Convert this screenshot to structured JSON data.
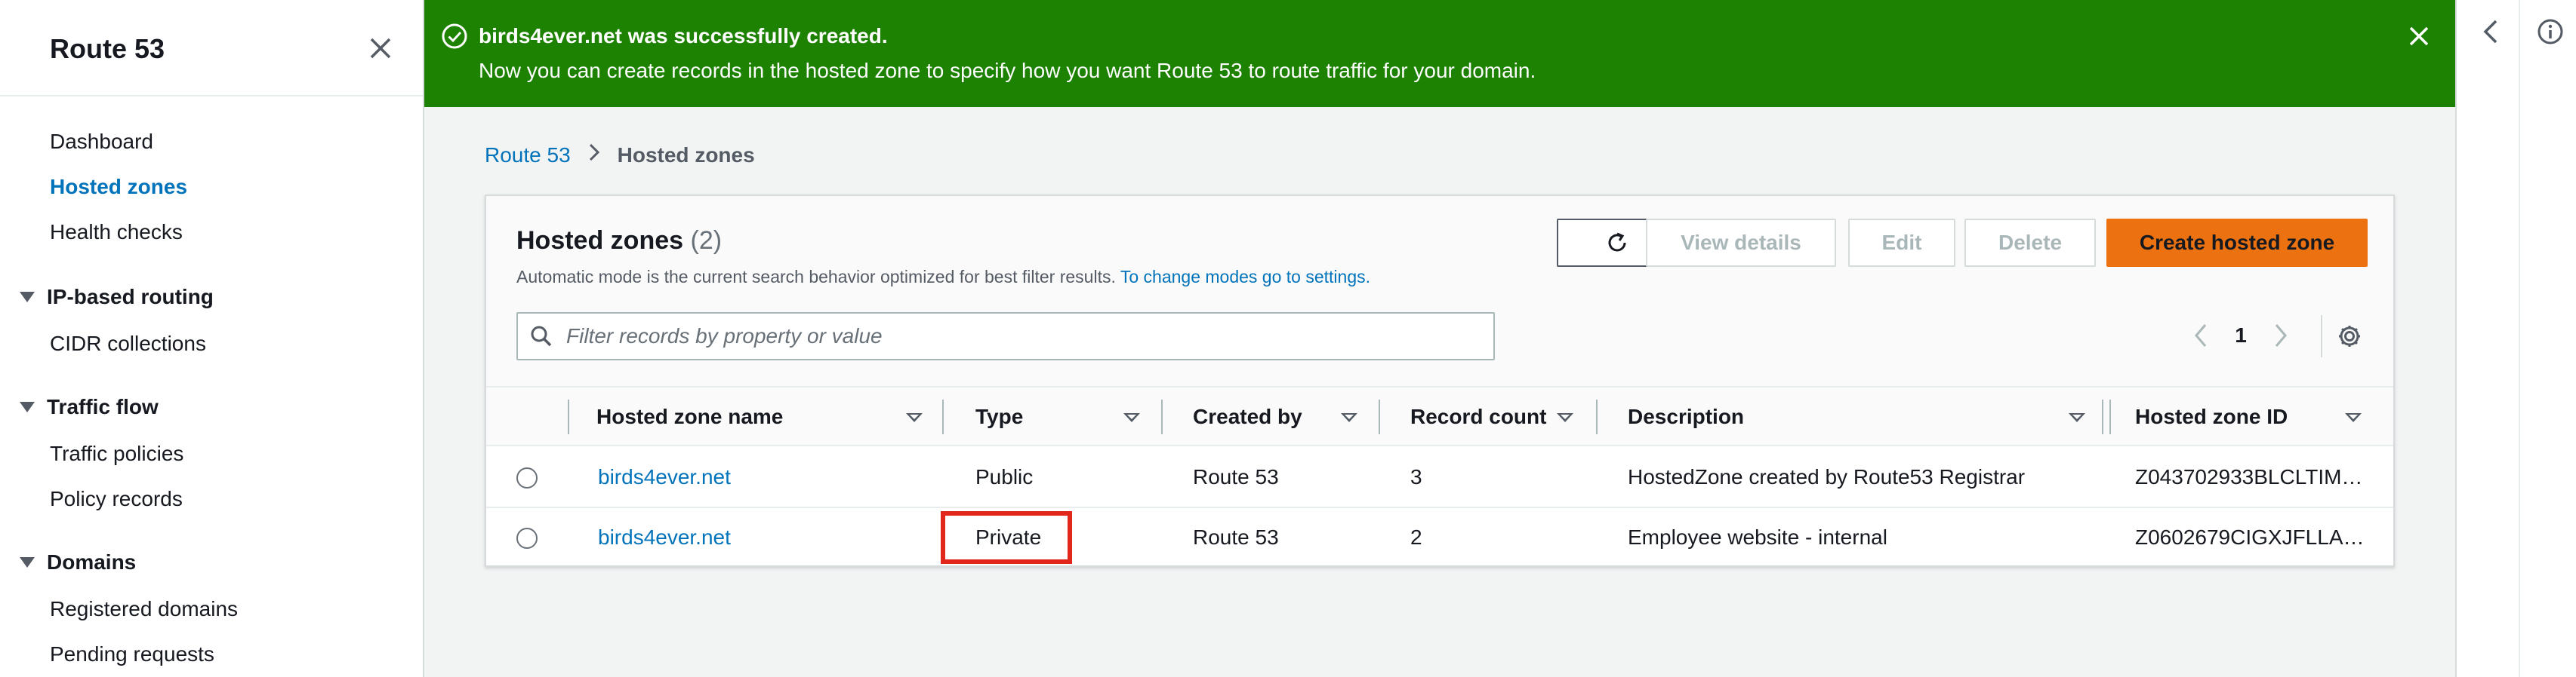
{
  "sidebar": {
    "title": "Route 53",
    "items": [
      {
        "label": "Dashboard"
      },
      {
        "label": "Hosted zones"
      },
      {
        "label": "Health checks"
      }
    ],
    "sections": [
      {
        "label": "IP-based routing",
        "items": [
          "CIDR collections"
        ]
      },
      {
        "label": "Traffic flow",
        "items": [
          "Traffic policies",
          "Policy records"
        ]
      },
      {
        "label": "Domains",
        "items": [
          "Registered domains",
          "Pending requests"
        ]
      }
    ]
  },
  "flash": {
    "title": "birds4ever.net was successfully created.",
    "message": "Now you can create records in the hosted zone to specify how you want Route 53 to route traffic for your domain.",
    "color": "#1d8102"
  },
  "breadcrumb": {
    "root": "Route 53",
    "current": "Hosted zones"
  },
  "panel": {
    "title": "Hosted zones",
    "count": "(2)",
    "description": "Automatic mode is the current search behavior optimized for best filter results.",
    "description_link": "To change modes go to settings.",
    "buttons": {
      "view": "View details",
      "edit": "Edit",
      "delete": "Delete",
      "create": "Create hosted zone"
    },
    "search_placeholder": "Filter records by property or value",
    "page": "1"
  },
  "table": {
    "columns": [
      "Hosted zone name",
      "Type",
      "Created by",
      "Record count",
      "Description",
      "Hosted zone ID"
    ],
    "rows": [
      {
        "name": "birds4ever.net",
        "type": "Public",
        "created_by": "Route 53",
        "record_count": "3",
        "description": "HostedZone created by Route53 Registrar",
        "id": "Z043702933BLCLTIM…"
      },
      {
        "name": "birds4ever.net",
        "type": "Private",
        "created_by": "Route 53",
        "record_count": "2",
        "description": "Employee website - internal",
        "id": "Z0602679CIGXJFLLA…"
      }
    ]
  },
  "colors": {
    "accent": "#0073bb",
    "primary_button": "#ec7211",
    "highlight": "#e1261c"
  }
}
